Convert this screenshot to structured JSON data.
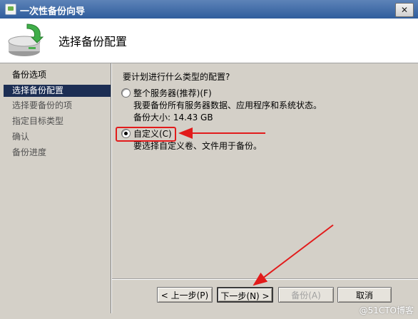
{
  "window": {
    "title": "一次性备份向导",
    "close_label": "✕"
  },
  "header": {
    "title": "选择备份配置"
  },
  "nav": {
    "items": [
      {
        "label": "备份选项"
      },
      {
        "label": "选择备份配置"
      },
      {
        "label": "选择要备份的项"
      },
      {
        "label": "指定目标类型"
      },
      {
        "label": "确认"
      },
      {
        "label": "备份进度"
      }
    ]
  },
  "content": {
    "question": "要计划进行什么类型的配置?",
    "options": [
      {
        "label": "整个服务器(推荐)(F)",
        "description": "我要备份所有服务器数据、应用程序和系统状态。",
        "size": "备份大小: 14.43 GB",
        "checked": false
      },
      {
        "label": "自定义(C)",
        "description": "要选择自定义卷、文件用于备份。",
        "checked": true
      }
    ]
  },
  "buttons": {
    "back": "< 上一步(P)",
    "next": "下一步(N) >",
    "backup": "备份(A)",
    "cancel": "取消"
  },
  "watermark": "@51CTO博客",
  "colors": {
    "annotation": "#e21b1b",
    "selected_nav": "#1c2e54"
  }
}
